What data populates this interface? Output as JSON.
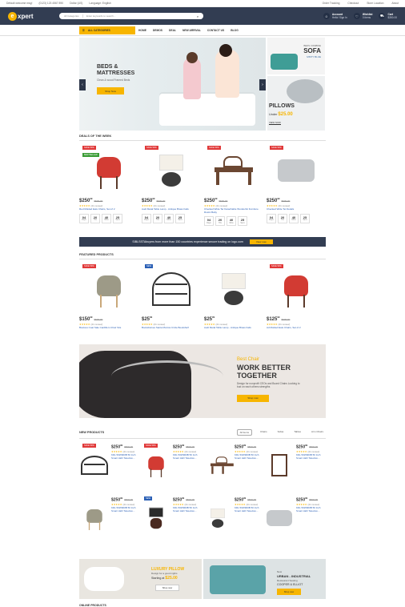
{
  "topbar": {
    "welcome": "Default welcome msg!",
    "phone": "(0123) 123 4567 890",
    "dollar": "Dollar (US)",
    "language": "Language: English",
    "links": [
      "Order Tracking",
      "Checkout",
      "Store Location",
      "About"
    ]
  },
  "header": {
    "logo": "xpert",
    "logo_letter": "e",
    "search_cat": "All Categories",
    "search_placeholder": "Enter keywords to search...",
    "account_title": "Account",
    "account_sub": "Hello! Sign In",
    "wishlist_title": "Wishlist",
    "wishlist_sub": "0 items",
    "cart_title": "Cart",
    "cart_sub": "$350.00"
  },
  "nav": {
    "categories": "ALL CATEGORIES",
    "menu": [
      "HOME",
      "DEMOS",
      "DEAL",
      "NEW ARRIVAL",
      "CONTACT US",
      "BLOG"
    ]
  },
  "hero": {
    "title": "BEDS & MATTRESSES",
    "subtitle": "Clean & wood Framed Beds",
    "button": "Shop Now"
  },
  "side1": {
    "top": "BEDS COMBINE",
    "title": "SOFA",
    "sub": "MISTY BLUE"
  },
  "side2": {
    "title": "PILLOWS",
    "under": "Under",
    "price": "$25.00",
    "link": "VIEW NOW"
  },
  "deals": {
    "title": "DEALS OF THE WEEK",
    "items": [
      {
        "badge": "SAVE 50%",
        "badge2": "BESTSELLER",
        "price": "$250",
        "cents": "99",
        "old": "$500.00",
        "reviews": "(21 review)",
        "name": "Red Molded Eats Chairs, Set of 2",
        "cd": [
          "04",
          "20",
          "40",
          "25"
        ]
      },
      {
        "badge": "SAVE 50%",
        "price": "$250",
        "cents": "99",
        "old": "$500.00",
        "reviews": "(21 review)",
        "name": "Audi Metal Table Lamp - Antique Brass Fails",
        "cd": [
          "04",
          "20",
          "40",
          "25"
        ]
      },
      {
        "badge": "SAVE 50%",
        "price": "$250",
        "cents": "99",
        "old": "$500.00",
        "reviews": "(21 review)",
        "name": "Checked Wide Tar Detachable Wonderful Furniture Rustic Baby",
        "cd": [
          "04",
          "20",
          "40",
          "25"
        ]
      },
      {
        "badge": "SAVE 50%",
        "price": "$250",
        "cents": "99",
        "old": "$500.00",
        "reviews": "(21 review)",
        "name": "Checked Wide Tet Details",
        "cd": [
          "04",
          "20",
          "40",
          "25"
        ]
      }
    ],
    "units": [
      "Days",
      "Hrs",
      "Mins",
      "Secs"
    ]
  },
  "banner": {
    "text": "SIBLSSTAbuyers from more than 150 countries experience secure trading on logo.com",
    "button": "View now"
  },
  "featured": {
    "title": "FEATURED PRODUCTS",
    "items": [
      {
        "badge": "SAVE 50%",
        "price": "$150",
        "cents": "99",
        "old": "$500.00",
        "reviews": "(21 review)",
        "name": "Boulous Coat Sale Cardillom Chair Sits"
      },
      {
        "badge": "NEW",
        "price": "$25",
        "cents": "99",
        "old": "",
        "reviews": "(21 review)",
        "name": "Bookshelves Santa Monica Circle Bookshelf"
      },
      {
        "badge": "",
        "price": "$25",
        "cents": "99",
        "old": "",
        "reviews": "(21 review)",
        "name": "Audi Metal Table Lamp - Antique Brass Fails"
      },
      {
        "badge": "SAVE 50%",
        "price": "$125",
        "cents": "99",
        "old": "$500.00",
        "reviews": "(21 review)",
        "name": "Ad Molded Eats Chairs, Set of 2"
      }
    ]
  },
  "promo": {
    "pre": "Best Chair",
    "title": "WORK BETTER TOGETHER",
    "desc": "Design for nonprofit CEOs and Board Chairs Looking to bud on each others strengths",
    "button": "Shop now"
  },
  "newp": {
    "title": "NEW PRODUCTS",
    "tabs": [
      "All items",
      "Chairs",
      "Sofas",
      "Tables",
      "Arm Chairs"
    ],
    "items": [
      {
        "badge": "SAVE 50%",
        "price": "$250",
        "cents": "99",
        "old": "$500.00",
        "reviews": "(21 review)",
        "name": "KDL 50W900B 50 Inch Smart LED Televisio..."
      },
      {
        "badge": "SAVE 50%",
        "price": "$250",
        "cents": "99",
        "old": "$500.00",
        "reviews": "(21 review)",
        "name": "KDL 50W900B 50 Inch Smart LED Televisio..."
      },
      {
        "badge": "",
        "price": "$250",
        "cents": "99",
        "old": "$500.00",
        "reviews": "(21 review)",
        "name": "KDL 50W900B 50 Inch Smart LED Televisio..."
      },
      {
        "badge": "",
        "price": "$250",
        "cents": "99",
        "old": "$500.00",
        "reviews": "(21 review)",
        "name": "KDL 50W900B 50 Inch Smart LED Televisio..."
      },
      {
        "badge": "",
        "price": "$250",
        "cents": "99",
        "old": "$500.00",
        "reviews": "(21 review)",
        "name": "KDL 50W900B 50 Inch Smart LED Televisio..."
      },
      {
        "badge": "NEW",
        "price": "$250",
        "cents": "99",
        "old": "$500.00",
        "reviews": "(21 review)",
        "name": "KDL 50W900B 50 Inch Smart LED Televisio..."
      },
      {
        "badge": "",
        "price": "$250",
        "cents": "99",
        "old": "$500.00",
        "reviews": "(21 review)",
        "name": "KDL 50W900B 50 Inch Smart LED Televisio..."
      },
      {
        "badge": "",
        "price": "$250",
        "cents": "99",
        "old": "$500.00",
        "reviews": "(21 review)",
        "name": "KDL 50W900B 50 Inch Smart LED Televisio..."
      }
    ]
  },
  "bottom": {
    "left": {
      "title": "LUXURY PILLOW",
      "sub": "Design for a good nights",
      "starting": "Starting at",
      "price": "$25.00",
      "button": "Shop now"
    },
    "right": {
      "pre": "New",
      "title": "URBAN - INDUSTRIAL",
      "sub": "Restaurant Seating",
      "brand": "COOPER & ELLIOT",
      "button": "Shop now"
    }
  },
  "footer_title": "ONLINE PRODUCTS",
  "colors": {
    "navy": "#323d52",
    "accent": "#f7b500",
    "sale": "#e03838",
    "new": "#2a5fb5"
  }
}
